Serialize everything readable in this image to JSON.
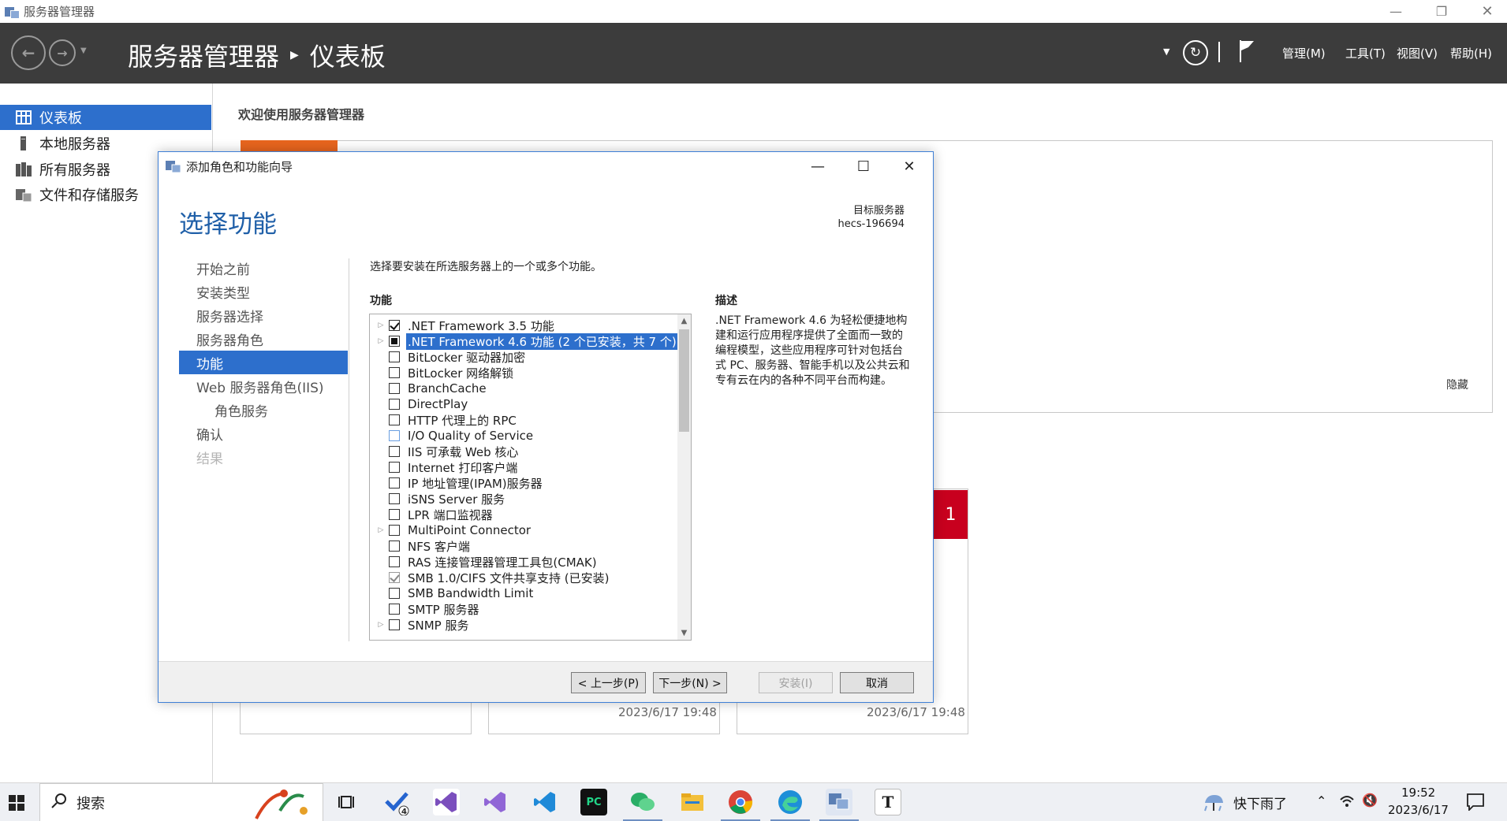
{
  "window": {
    "title": "服务器管理器",
    "controls": [
      "minimize-icon",
      "restore-icon",
      "close-icon"
    ]
  },
  "header": {
    "app": "服务器管理器",
    "page": "仪表板",
    "menus": [
      "管理(M)",
      "工具(T)",
      "视图(V)",
      "帮助(H)"
    ]
  },
  "sidebar": {
    "items": [
      {
        "label": "仪表板",
        "icon": "dashboard-icon",
        "active": true
      },
      {
        "label": "本地服务器",
        "icon": "server-icon",
        "active": false
      },
      {
        "label": "所有服务器",
        "icon": "servers-icon",
        "active": false
      },
      {
        "label": "文件和存储服务",
        "icon": "storage-icon",
        "active": false
      }
    ]
  },
  "main": {
    "welcome": "欢迎使用服务器管理器",
    "hide": "隐藏",
    "badge_count": "1",
    "tile_dates": [
      "2023/6/17 19:48",
      "2023/6/17 19:48"
    ]
  },
  "dialog": {
    "title": "添加角色和功能向导",
    "heading": "选择功能",
    "dest_label": "目标服务器",
    "dest_server": "hecs-196694",
    "steps": [
      {
        "label": "开始之前",
        "state": "normal"
      },
      {
        "label": "安装类型",
        "state": "normal"
      },
      {
        "label": "服务器选择",
        "state": "normal"
      },
      {
        "label": "服务器角色",
        "state": "normal"
      },
      {
        "label": "功能",
        "state": "active"
      },
      {
        "label": "Web 服务器角色(IIS)",
        "state": "normal"
      },
      {
        "label": "角色服务",
        "state": "sub"
      },
      {
        "label": "确认",
        "state": "normal"
      },
      {
        "label": "结果",
        "state": "disabled"
      }
    ],
    "instruction": "选择要安装在所选服务器上的一个或多个功能。",
    "features_label": "功能",
    "description_label": "描述",
    "description": ".NET Framework 4.6 为轻松便捷地构建和运行应用程序提供了全面而一致的编程模型，这些应用程序可针对包括台式 PC、服务器、智能手机以及公共云和专有云在内的各种不同平台而构建。",
    "features": [
      {
        "label": ".NET Framework 3.5 功能",
        "expand": true,
        "state": "checked"
      },
      {
        "label": ".NET Framework 4.6 功能 (2 个已安装，共 7 个)",
        "expand": true,
        "state": "partial",
        "selected": true
      },
      {
        "label": "BitLocker 驱动器加密",
        "expand": false,
        "state": "unchecked"
      },
      {
        "label": "BitLocker 网络解锁",
        "expand": false,
        "state": "unchecked"
      },
      {
        "label": "BranchCache",
        "expand": false,
        "state": "unchecked"
      },
      {
        "label": "DirectPlay",
        "expand": false,
        "state": "unchecked"
      },
      {
        "label": "HTTP 代理上的 RPC",
        "expand": false,
        "state": "unchecked"
      },
      {
        "label": "I/O Quality of Service",
        "expand": false,
        "state": "hover"
      },
      {
        "label": "IIS 可承载 Web 核心",
        "expand": false,
        "state": "unchecked"
      },
      {
        "label": "Internet 打印客户端",
        "expand": false,
        "state": "unchecked"
      },
      {
        "label": "IP 地址管理(IPAM)服务器",
        "expand": false,
        "state": "unchecked"
      },
      {
        "label": "iSNS Server 服务",
        "expand": false,
        "state": "unchecked"
      },
      {
        "label": "LPR 端口监视器",
        "expand": false,
        "state": "unchecked"
      },
      {
        "label": "MultiPoint Connector",
        "expand": true,
        "state": "unchecked"
      },
      {
        "label": "NFS 客户端",
        "expand": false,
        "state": "unchecked"
      },
      {
        "label": "RAS 连接管理器管理工具包(CMAK)",
        "expand": false,
        "state": "unchecked"
      },
      {
        "label": "SMB 1.0/CIFS 文件共享支持 (已安装)",
        "expand": false,
        "state": "installed"
      },
      {
        "label": "SMB Bandwidth Limit",
        "expand": false,
        "state": "unchecked"
      },
      {
        "label": "SMTP 服务器",
        "expand": false,
        "state": "unchecked"
      },
      {
        "label": "SNMP 服务",
        "expand": true,
        "state": "unchecked"
      }
    ],
    "buttons": {
      "prev": "< 上一步(P)",
      "next": "下一步(N) >",
      "install": "安装(I)",
      "cancel": "取消"
    }
  },
  "taskbar": {
    "search": "搜索",
    "weather": "快下雨了",
    "time": "19:52",
    "date": "2023/6/17",
    "badge": "4"
  }
}
